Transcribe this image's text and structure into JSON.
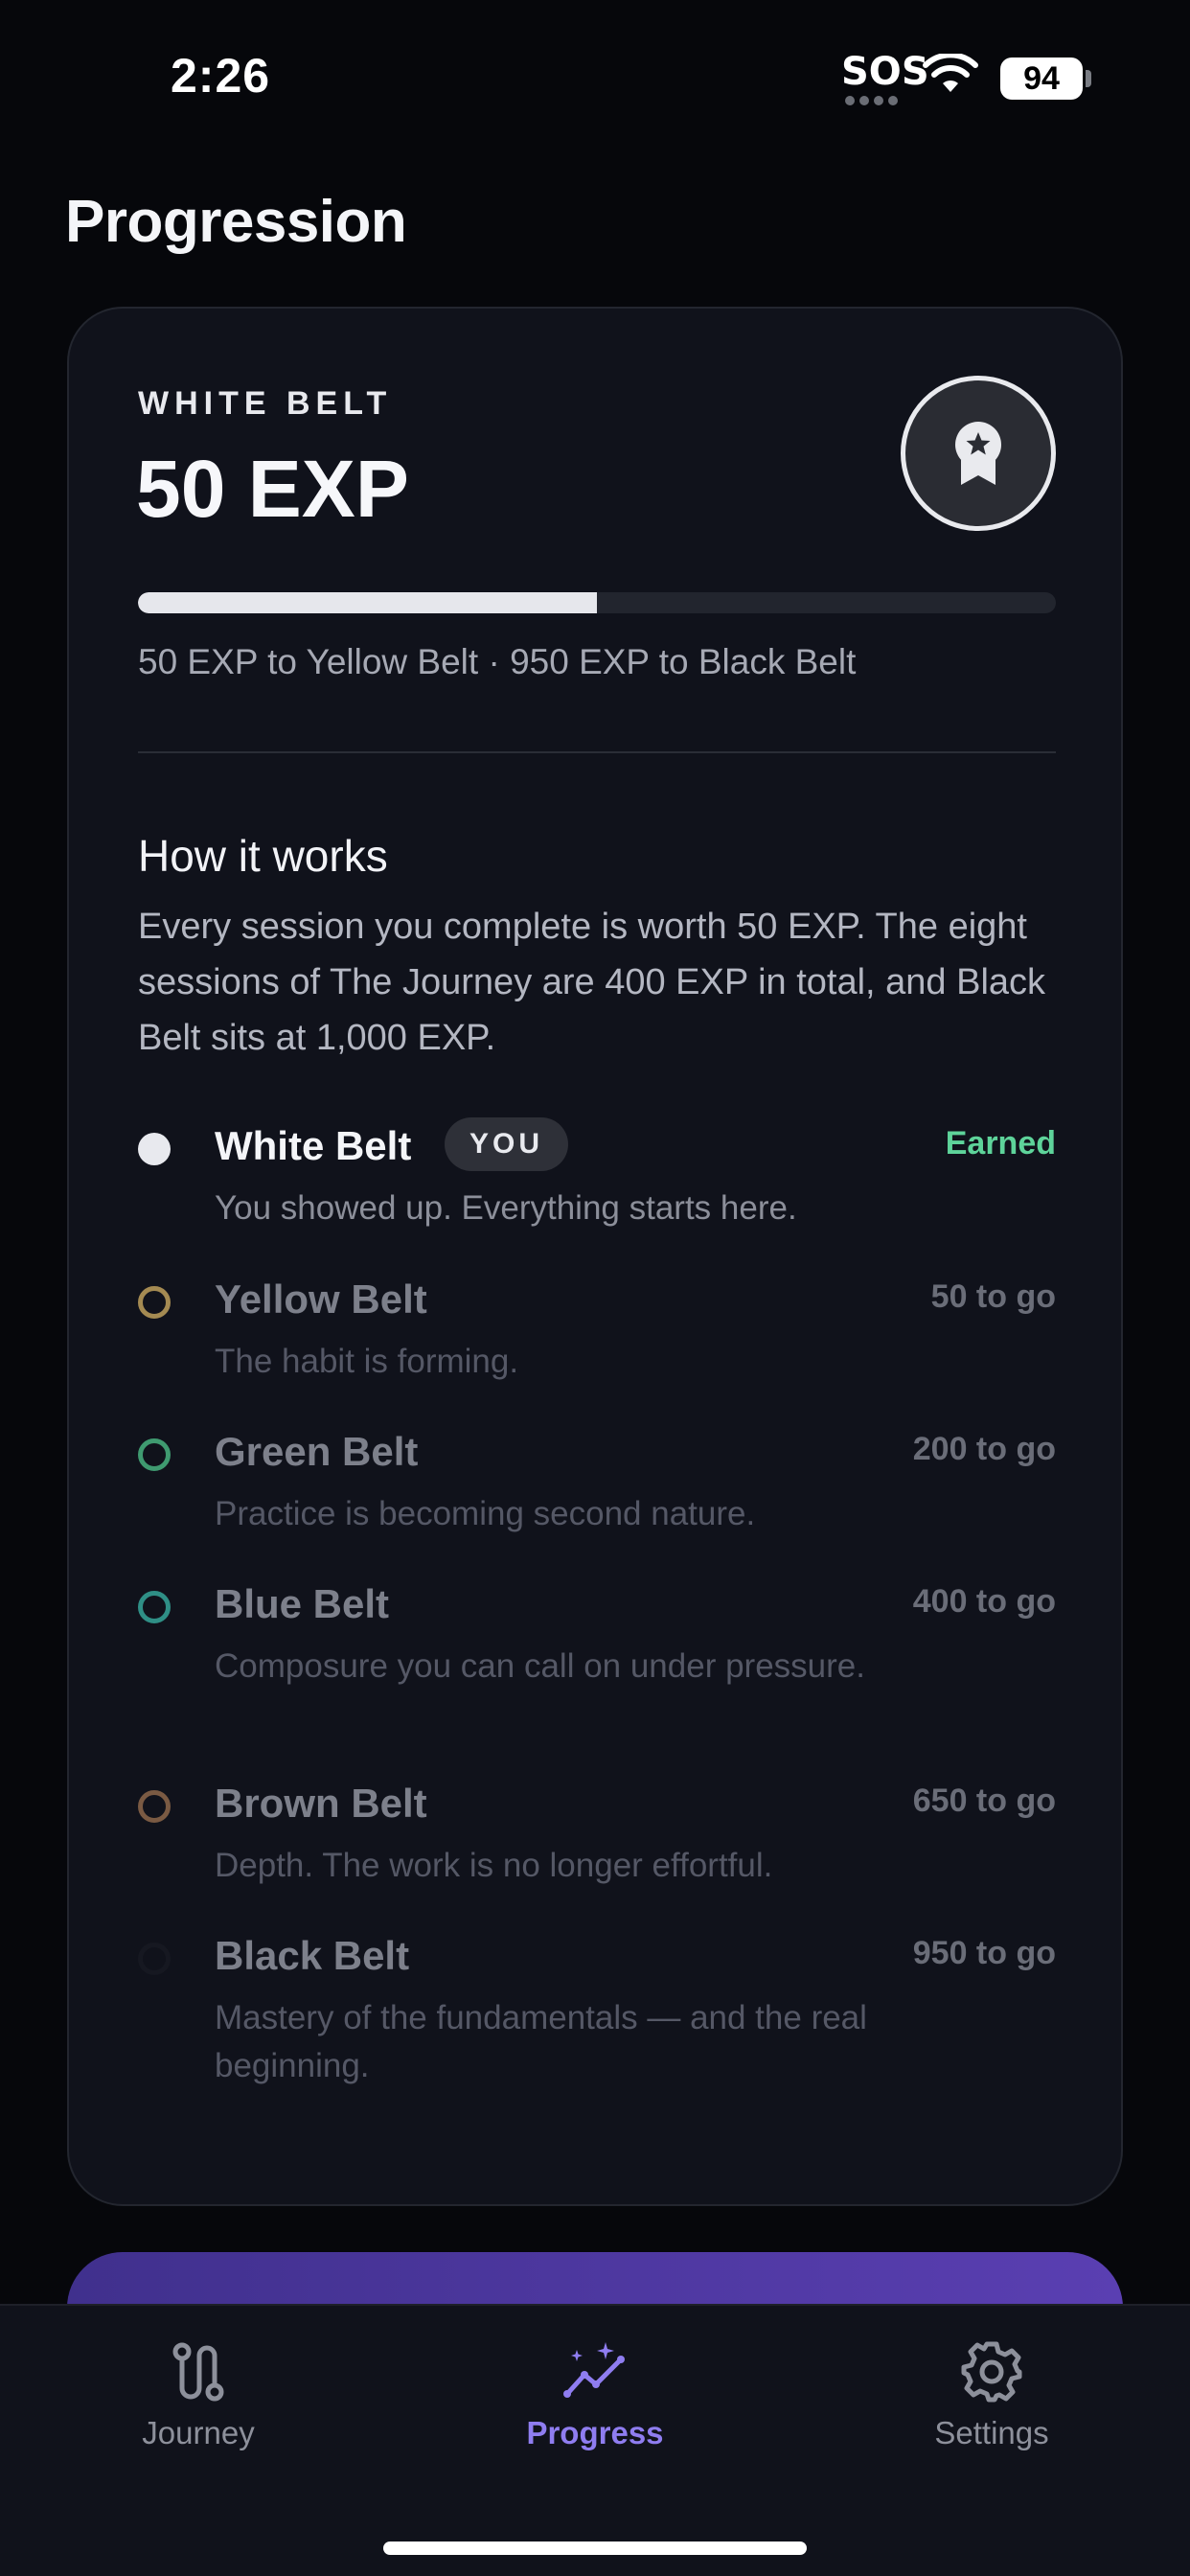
{
  "status_bar": {
    "time": "2:26",
    "sos": "SOS",
    "battery": "94"
  },
  "page": {
    "title": "Progression"
  },
  "summary": {
    "belt_label": "WHITE BELT",
    "exp": "50 EXP",
    "progress_fraction": 0.5,
    "progress_text": "50 EXP to Yellow Belt · 950 EXP to Black Belt",
    "badge_icon": "award-ribbon-icon"
  },
  "how_it_works": {
    "title": "How it works",
    "body": "Every session you complete is worth 50 EXP. The eight sessions of The Journey are 400 EXP in total, and Black Belt sits at 1,000 EXP."
  },
  "belts": [
    {
      "name": "White Belt",
      "desc": "You showed up. Everything starts here.",
      "status": "Earned",
      "you_label": "YOU",
      "dot_color": "#e8e9ee",
      "dot_style": "filled",
      "status_color": "#5ed39a"
    },
    {
      "name": "Yellow Belt",
      "desc": "The habit is forming.",
      "status": "50 to go",
      "dot_color": "#a48a52",
      "dot_style": "ring"
    },
    {
      "name": "Green Belt",
      "desc": "Practice is becoming second nature.",
      "status": "200 to go",
      "dot_color": "#3f9a70",
      "dot_style": "ring"
    },
    {
      "name": "Blue Belt",
      "desc": "Composure you can call on under pressure.",
      "status": "400 to go",
      "dot_color": "#2f8f86",
      "dot_style": "ring"
    },
    {
      "name": "Brown Belt",
      "desc": "Depth. The work is no longer effortful.",
      "status": "650 to go",
      "dot_color": "#7a5a43",
      "dot_style": "ring"
    },
    {
      "name": "Black Belt",
      "desc": "Mastery of the fundamentals — and the real beginning.",
      "status": "950 to go",
      "dot_color": "#161821",
      "dot_style": "ring"
    }
  ],
  "tabs": [
    {
      "label": "Journey",
      "icon": "route-icon",
      "active": false
    },
    {
      "label": "Progress",
      "icon": "trend-sparkle-icon",
      "active": true
    },
    {
      "label": "Settings",
      "icon": "gear-icon",
      "active": false
    }
  ],
  "colors": {
    "accent": "#8f7df0",
    "inactive": "#8d909b",
    "background": "#06070b",
    "card": "#10121b"
  }
}
